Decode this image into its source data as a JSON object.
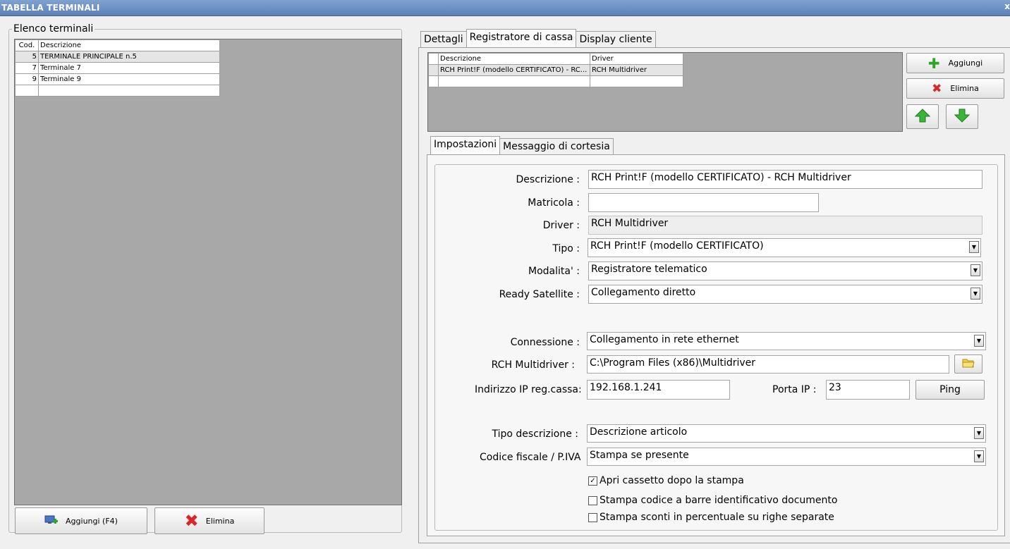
{
  "window": {
    "title": "TABELLA TERMINALI",
    "close_glyph": "x"
  },
  "terminals": {
    "legend": "Elenco terminali",
    "columns": [
      "Cod.",
      "Descrizione"
    ],
    "rows": [
      {
        "cod": "5",
        "desc": "TERMINALE PRINCIPALE n.5"
      },
      {
        "cod": "7",
        "desc": "Terminale 7"
      },
      {
        "cod": "9",
        "desc": "Terminale 9"
      }
    ],
    "add_label": "Aggiungi (F4)",
    "delete_label": "Elimina"
  },
  "main_tabs": [
    "Dettagli",
    "Registratore di cassa",
    "Display cliente"
  ],
  "devices": {
    "columns": [
      "Descrizione",
      "Driver"
    ],
    "rows": [
      {
        "desc": "RCH Print!F (modello CERTIFICATO) - RC...",
        "driver": "RCH Multidriver"
      }
    ],
    "add_label": "Aggiungi",
    "delete_label": "Elimina"
  },
  "sub_tabs": [
    "Impostazioni",
    "Messaggio di cortesia"
  ],
  "form": {
    "descrizione_label": "Descrizione :",
    "descrizione_value": "RCH Print!F (modello CERTIFICATO) - RCH Multidriver",
    "matricola_label": "Matricola :",
    "matricola_value": "",
    "driver_label": "Driver :",
    "driver_value": "RCH Multidriver",
    "tipo_label": "Tipo :",
    "tipo_value": "RCH Print!F (modello CERTIFICATO)",
    "modalita_label": "Modalita' :",
    "modalita_value": "Registratore telematico",
    "ready_label": "Ready Satellite :",
    "ready_value": "Collegamento diretto",
    "connessione_label": "Connessione :",
    "connessione_value": "Collegamento in rete ethernet",
    "multidriver_label": "RCH Multidriver :",
    "multidriver_value": "C:\\Program Files (x86)\\Multidriver",
    "ip_label": "Indirizzo IP reg.cassa:",
    "ip_value": "192.168.1.241",
    "porta_label": "Porta IP :",
    "porta_value": "23",
    "ping_label": "Ping",
    "tipo_desc_label": "Tipo descrizione :",
    "tipo_desc_value": "Descrizione articolo",
    "cf_label": "Codice fiscale / P.IVA",
    "cf_value": "Stampa se presente",
    "chk1_label": "Apri cassetto dopo la stampa",
    "chk1_checked": "✓",
    "chk2_label": "Stampa codice a barre identificativo documento",
    "chk3_label": "Stampa sconti in percentuale su righe separate"
  },
  "colors": {
    "add_green": "#2fa52a",
    "delete_red": "#d9262a",
    "arrow_green": "#3bb43a",
    "grid_bg": "#a8a8a8"
  }
}
